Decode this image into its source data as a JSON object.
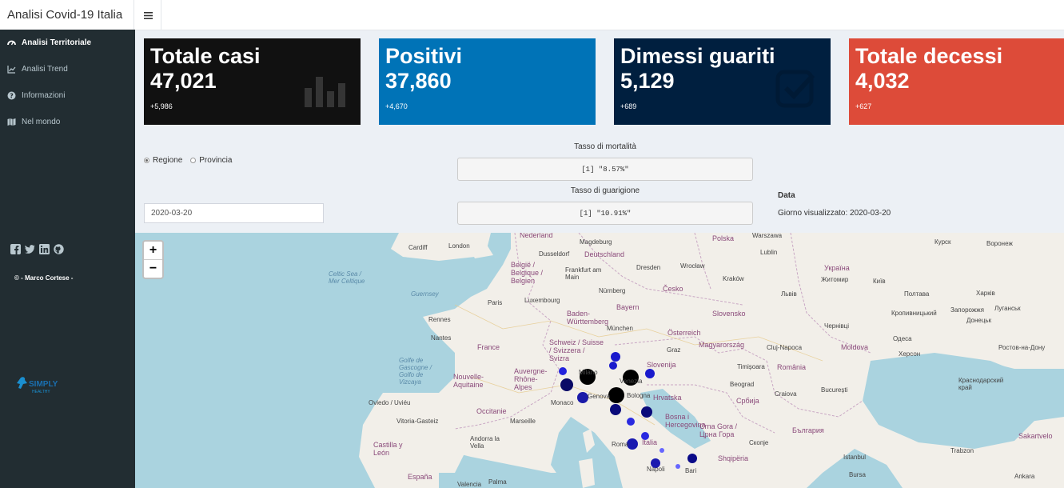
{
  "app": {
    "title": "Analisi Covid-19 Italia"
  },
  "sidebar": {
    "items": [
      {
        "label": "Analisi Territoriale",
        "icon": "dashboard-icon",
        "active": true
      },
      {
        "label": "Analisi Trend",
        "icon": "line-chart-icon",
        "active": false
      },
      {
        "label": "Informazioni",
        "icon": "question-circle-icon",
        "active": false
      },
      {
        "label": "Nel mondo",
        "icon": "map-icon",
        "active": false
      }
    ],
    "social": [
      "facebook-icon",
      "twitter-icon",
      "linkedin-icon",
      "github-icon"
    ],
    "credit": "© - Marco Cortese -"
  },
  "boxes": [
    {
      "title": "Totale casi",
      "value": "47,021",
      "delta": "+5,986",
      "color": "#111111",
      "icon": "bar-chart-icon"
    },
    {
      "title": "Positivi",
      "value": "37,860",
      "delta": "+4,670",
      "color": "#0073b7",
      "icon": "none"
    },
    {
      "title": "Dimessi guariti",
      "value": "5,129",
      "delta": "+689",
      "color": "#001f3f",
      "icon": "check-square-icon"
    },
    {
      "title": "Totale decessi",
      "value": "4,032",
      "delta": "+627",
      "color": "#dd4b39",
      "icon": "none"
    }
  ],
  "controls": {
    "radio": [
      {
        "label": "Regione",
        "selected": true
      },
      {
        "label": "Provincia",
        "selected": false
      }
    ],
    "date_value": "2020-03-20",
    "mortality_label": "Tasso di mortalità",
    "mortality_value": "[1] \"8.57%\"",
    "recovery_label": "Tasso di guarigione",
    "recovery_value": "[1] \"10.91%\"",
    "data_heading": "Data",
    "data_text": "Giorno visualizzato: 2020-03-20"
  },
  "map": {
    "zoom_in": "+",
    "zoom_out": "−",
    "labels": [
      "Nederland",
      "Magdeburg",
      "Polska",
      "Warszawa",
      "Cardiff",
      "London",
      "Dusseldorf",
      "Deutschland",
      "Lublin",
      "Курск",
      "Воронеж",
      "België / Belgique / Belgien",
      "Frankfurt am Main",
      "Dresden",
      "Wrocław",
      "Česko",
      "Kraków",
      "Україна",
      "Київ",
      "Житомир",
      "Luxembourg",
      "Paris",
      "Nürnberg",
      "Guernsey",
      "Rennes",
      "Bayern",
      "Baden-Württemberg",
      "München",
      "Österreich",
      "Slovensko",
      "Львів",
      "Полтава",
      "Харків",
      "Nantes",
      "France",
      "Schweiz / Suisse / Svizzera / Svizra",
      "Graz",
      "Magyarország",
      "Cluj-Napoca",
      "Moldova",
      "Одеса",
      "Херсон",
      "Ростов-на-Дону",
      "Celtic Sea / Mer Celtique",
      "Golfe de Gascogne / Golfo de Vizcaya",
      "Auvergne-Rhône-Alpes",
      "Nouvelle-Aquitaine",
      "Occitanie",
      "Slovenija",
      "Hrvatska",
      "România",
      "Timișoara",
      "Beograd",
      "Србија",
      "Craiova",
      "București",
      "Milano",
      "Venezia",
      "Genova",
      "Bologna",
      "Monaco",
      "Marseille",
      "Oviedo / Uviéu",
      "Vitoria-Gasteiz",
      "Andorra la Vella",
      "Castilla y León",
      "Crna Gora / Црна Гора",
      "Bosna i Hercegovina",
      "Скопје",
      "България",
      "Roma",
      "Italia",
      "Napoli",
      "Bari",
      "Shqipëria",
      "Valencia",
      "España",
      "Palma",
      "Istanbul",
      "Bursa",
      "Trabzon",
      "Sakartvelo",
      "Ankara",
      "Краснодарский край",
      "Запорожжя",
      "Кропивницький",
      "Чернівці",
      "Луганськ",
      "Донецьк"
    ]
  }
}
